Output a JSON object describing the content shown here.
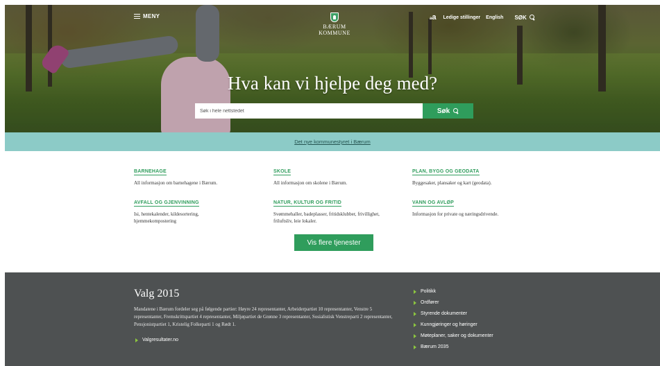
{
  "header": {
    "menu_label": "MENY",
    "logo_line1": "BÆRUM",
    "logo_line2": "KOMMUNE",
    "font_size_small": "a",
    "font_size_large": "a",
    "nav": [
      "Ledige stillinger",
      "English"
    ],
    "search_label": "SØK"
  },
  "hero": {
    "headline": "Hva kan vi hjelpe deg med?",
    "search_placeholder": "Søk i hele nettstedet",
    "search_button": "Søk"
  },
  "banner": {
    "link": "Det nye kommunestyret i Bærum"
  },
  "services": [
    {
      "title": "BARNEHAGE",
      "desc": "All informasjon om barnehagene i Bærum."
    },
    {
      "title": "SKOLE",
      "desc": "All informasjon om skolene i Bærum."
    },
    {
      "title": "PLAN, BYGG OG GEODATA",
      "desc": "Byggesaker, plansaker og kart (geodata)."
    },
    {
      "title": "AVFALL OG GJENVINNING",
      "desc": "Isi, hentekalender, kildesortering, hjemmekompostering"
    },
    {
      "title": "NATUR, KULTUR OG FRITID",
      "desc": "Svømmehaller, badeplasser, fritidsklubber, frivillighet, friluftsliv, leie lokaler."
    },
    {
      "title": "VANN OG AVLØP",
      "desc": "Informasjon for private og næringsdrivende."
    }
  ],
  "more_services": "Vis flere tjenester",
  "footer": {
    "title": "Valg 2015",
    "body": "Mandatene i Bærum fordeler seg på følgende partier: Høyre 24 representanter, Arbeiderpartiet 10 representanter, Venstre 5 representanter, Fremskrittspartiet 4 representanter, Miljøpartiet de Grønne 3 representanter, Sosialistisk Venstreparti 2 representanter, Pensjonistpartiet 1, Kristelig Folkeparti 1 og Rødt 1.",
    "result_link": "Valgresultater.no",
    "links": [
      "Politikk",
      "Ordfører",
      "Styrende dokumenter",
      "Kunngjøringer og høringer",
      "Møteplaner, saker og dokumenter",
      "Bærum 2035"
    ]
  },
  "colors": {
    "accent_green": "#2f9d5c",
    "banner_teal": "#8ccbc7",
    "footer_gray": "#4e5152",
    "arrow_green": "#8cc63f"
  }
}
